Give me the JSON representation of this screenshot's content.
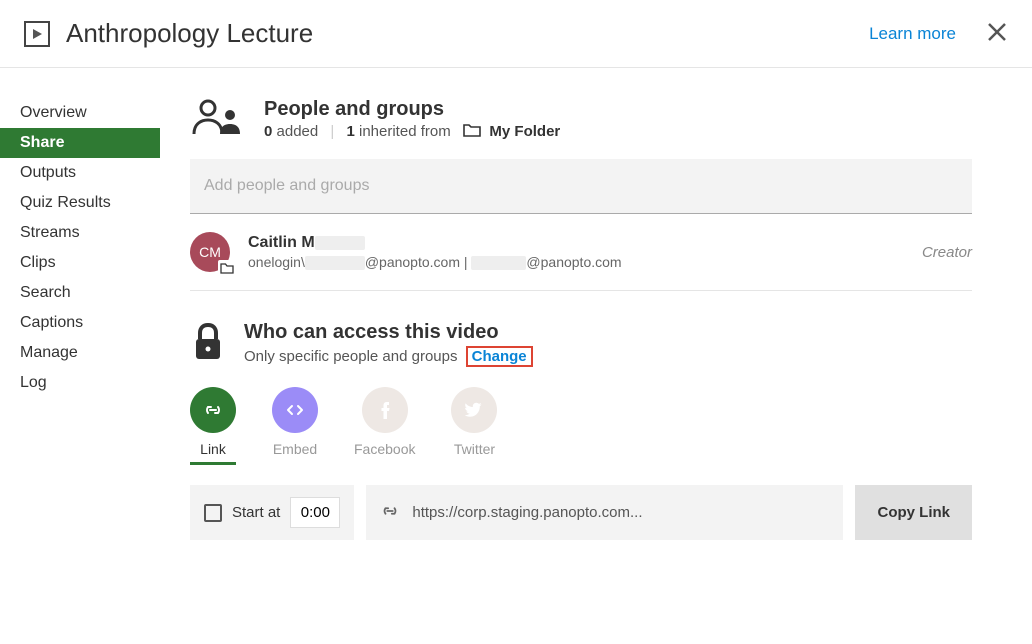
{
  "header": {
    "title": "Anthropology Lecture",
    "learn_more": "Learn more"
  },
  "sidebar": {
    "items": [
      {
        "label": "Overview"
      },
      {
        "label": "Share"
      },
      {
        "label": "Outputs"
      },
      {
        "label": "Quiz Results"
      },
      {
        "label": "Streams"
      },
      {
        "label": "Clips"
      },
      {
        "label": "Search"
      },
      {
        "label": "Captions"
      },
      {
        "label": "Manage"
      },
      {
        "label": "Log"
      }
    ],
    "active_index": 1
  },
  "people_section": {
    "title": "People and groups",
    "added_count": "0",
    "added_label": "added",
    "inherited_count": "1",
    "inherited_label": "inherited from",
    "inherited_folder": "My Folder",
    "input_placeholder": "Add people and groups"
  },
  "person": {
    "initials": "CM",
    "name_prefix": "Caitlin M",
    "sub_prefix": "onelogin\\",
    "domain1": "@panopto.com",
    "sep": " | ",
    "domain2": "@panopto.com",
    "role": "Creator"
  },
  "access_section": {
    "title": "Who can access this video",
    "subtitle": "Only specific people and groups",
    "change_label": "Change"
  },
  "share_tabs": {
    "link": "Link",
    "embed": "Embed",
    "facebook": "Facebook",
    "twitter": "Twitter"
  },
  "link_bar": {
    "start_at_label": "Start at",
    "start_at_time": "0:00",
    "url": "https://corp.staging.panopto.com...",
    "copy_label": "Copy Link"
  }
}
